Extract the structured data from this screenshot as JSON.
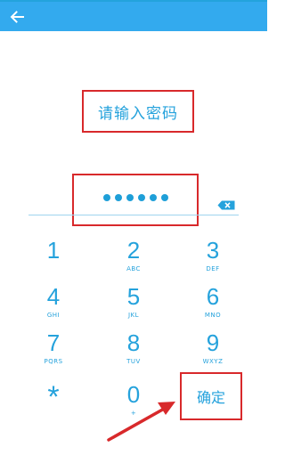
{
  "colors": {
    "app_bar": "#33aaee",
    "accent": "#25a2dc",
    "highlight": "#d8292b"
  },
  "header": {
    "back_icon": "arrow-left-icon"
  },
  "prompt": {
    "text": "请输入密码"
  },
  "pin": {
    "entered_digits": 6,
    "masked": "••••••",
    "delete_icon": "backspace-icon"
  },
  "keypad": {
    "keys": [
      {
        "num": "1",
        "sub": ""
      },
      {
        "num": "2",
        "sub": "ABC"
      },
      {
        "num": "3",
        "sub": "DEF"
      },
      {
        "num": "4",
        "sub": "GHI"
      },
      {
        "num": "5",
        "sub": "JKL"
      },
      {
        "num": "6",
        "sub": "MNO"
      },
      {
        "num": "7",
        "sub": "PQRS"
      },
      {
        "num": "8",
        "sub": "TUV"
      },
      {
        "num": "9",
        "sub": "WXYZ"
      },
      {
        "num": "*",
        "sub": ""
      },
      {
        "num": "0",
        "sub": "+"
      }
    ],
    "confirm_label": "确定"
  },
  "annotations": {
    "arrow_icon": "red-pointer-arrow-icon"
  }
}
